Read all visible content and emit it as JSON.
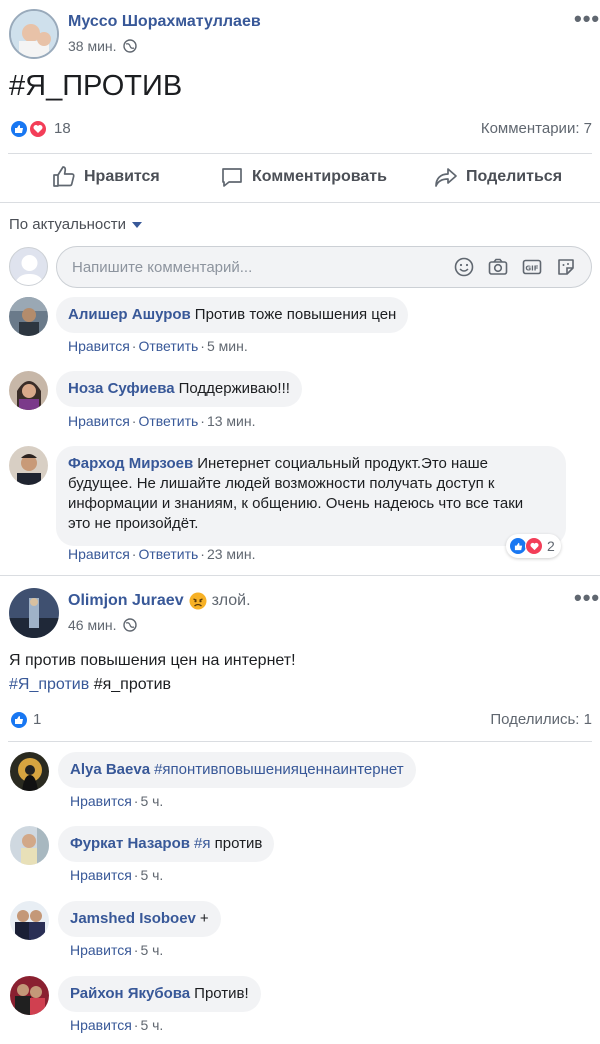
{
  "post1": {
    "author": "Муссо Шорахматуллаев",
    "time": "38 мин.",
    "text": "#Я_ПРОТИВ",
    "reactions_count": "18",
    "comments_count": "Комментарии: 7",
    "actions": {
      "like": "Нравится",
      "comment": "Комментировать",
      "share": "Поделиться"
    },
    "sort_label": "По актуальности",
    "comment_placeholder": "Напишите комментарий...",
    "comments": [
      {
        "name": "Алишер Ашуров",
        "text": "Против тоже повышения цен",
        "like": "Нравится",
        "reply": "Ответить",
        "time": "5 мин."
      },
      {
        "name": "Ноза Суфиева",
        "text": "Поддерживаю!!!",
        "like": "Нравится",
        "reply": "Ответить",
        "time": "13 мин."
      },
      {
        "name": "Фарход Мирзоев",
        "text_l1": "Инетернет социальный продукт.Это наше",
        "text_l2": "будущее. Не лишайте людей возможности получать доступ к",
        "text_l3": "информации и знаниям, к общению. Очень надеюсь что все таки",
        "text_l4": "это не произойдёт.",
        "like": "Нравится",
        "reply": "Ответить",
        "time": "23 мин.",
        "reactions": "2"
      }
    ]
  },
  "post2": {
    "author": "Olimjon Juraev",
    "feeling": "злой.",
    "time": "46 мин.",
    "text": "Я против повышения цен на интернет!",
    "hashtag1": "#Я_против",
    "hashtag2": "#я_против",
    "reactions_count": "1",
    "shares": "Поделились: 1",
    "comments": [
      {
        "name": "Alya Baeva",
        "tag": "#японтивповышенияценнаинтернет",
        "like": "Нравится",
        "time": "5 ч."
      },
      {
        "name": "Фуркат Назаров",
        "tag": "#я",
        "text": "против",
        "like": "Нравится",
        "time": "5 ч."
      },
      {
        "name": "Jamshed Isoboev",
        "text": "+",
        "like": "Нравится",
        "time": "5 ч."
      },
      {
        "name": "Райхон Якубова",
        "text": "Против!",
        "like": "Нравится",
        "time": "5 ч."
      }
    ]
  },
  "colors": {
    "link": "#385898",
    "like": "#1877f2",
    "love": "#f33e58",
    "bubble": "#f2f3f5"
  }
}
